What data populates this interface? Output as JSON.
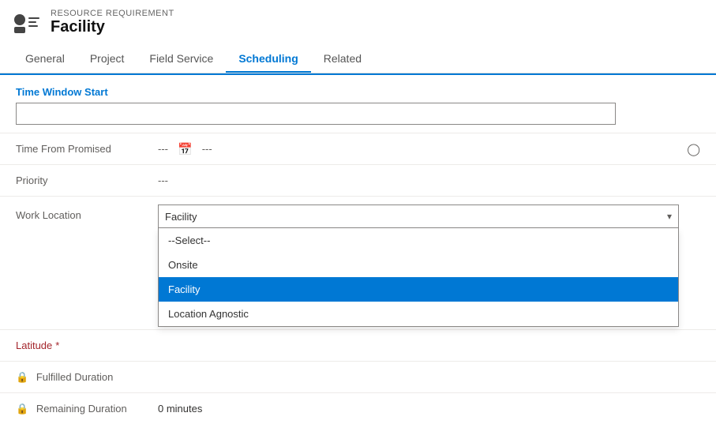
{
  "record": {
    "type_label": "RESOURCE REQUIREMENT",
    "name": "Facility"
  },
  "tabs": [
    {
      "id": "general",
      "label": "General",
      "active": false
    },
    {
      "id": "project",
      "label": "Project",
      "active": false
    },
    {
      "id": "field-service",
      "label": "Field Service",
      "active": false
    },
    {
      "id": "scheduling",
      "label": "Scheduling",
      "active": true
    },
    {
      "id": "related",
      "label": "Related",
      "active": false
    }
  ],
  "form": {
    "section_title": "Time Window Start",
    "time_window_input_value": "",
    "fields": [
      {
        "id": "time-from-promised",
        "label": "Time From Promised",
        "required": false,
        "locked": false,
        "value": "---",
        "extra_value": "---",
        "has_calendar": true,
        "has_clock": true
      },
      {
        "id": "priority",
        "label": "Priority",
        "required": false,
        "locked": false,
        "value": "---"
      },
      {
        "id": "work-location",
        "label": "Work Location",
        "required": false,
        "locked": false,
        "is_dropdown": true,
        "selected": "Facility"
      },
      {
        "id": "latitude",
        "label": "Latitude",
        "required": true,
        "locked": false,
        "value": ""
      },
      {
        "id": "fulfilled-duration",
        "label": "Fulfilled Duration",
        "required": false,
        "locked": true,
        "value": ""
      },
      {
        "id": "remaining-duration",
        "label": "Remaining Duration",
        "required": false,
        "locked": true,
        "value": "0 minutes"
      }
    ],
    "dropdown_options": [
      {
        "value": "--Select--",
        "label": "--Select--"
      },
      {
        "value": "Onsite",
        "label": "Onsite"
      },
      {
        "value": "Facility",
        "label": "Facility"
      },
      {
        "value": "Location Agnostic",
        "label": "Location Agnostic"
      }
    ]
  },
  "icons": {
    "resource_icon": "person-lines",
    "lock": "🔒",
    "calendar": "📅",
    "clock": "🕐",
    "chevron_down": "▾"
  }
}
